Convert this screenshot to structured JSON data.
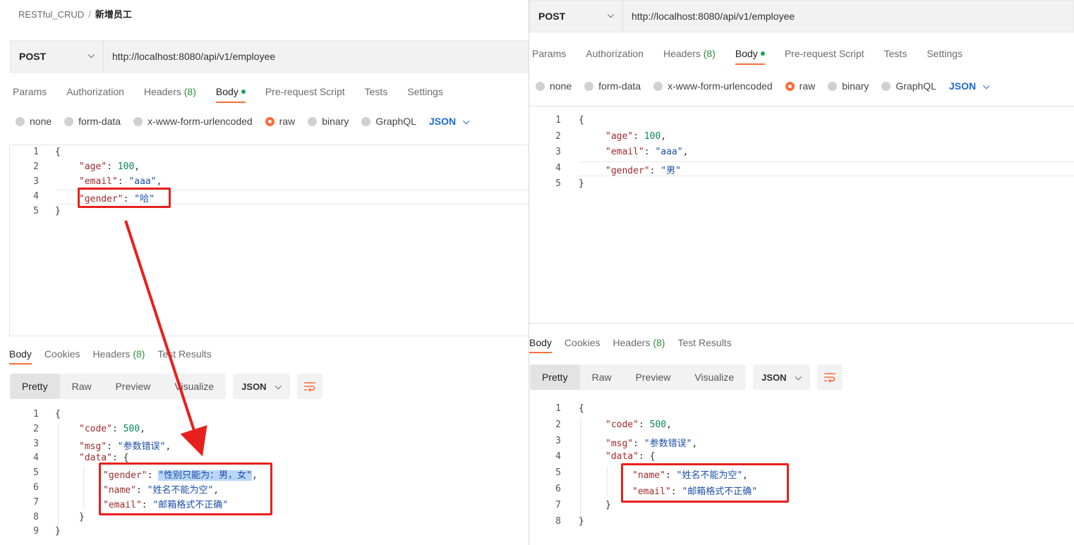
{
  "left": {
    "breadcrumb": {
      "collection": "RESTful_CRUD",
      "sep": "/",
      "request": "新增员工"
    },
    "method": "POST",
    "url": "http://localhost:8080/api/v1/employee",
    "tabs": [
      {
        "label": "Params"
      },
      {
        "label": "Authorization"
      },
      {
        "label": "Headers",
        "count": "(8)"
      },
      {
        "label": "Body",
        "active": true
      },
      {
        "label": "Pre-request Script"
      },
      {
        "label": "Tests"
      },
      {
        "label": "Settings"
      }
    ],
    "body_types": [
      "none",
      "form-data",
      "x-www-form-urlencoded",
      "raw",
      "binary",
      "GraphQL"
    ],
    "body_format": "JSON",
    "request_lines": [
      {
        "n": "1",
        "text": "{"
      },
      {
        "n": "2",
        "key": "\"age\"",
        "val": "100",
        "type": "num",
        "tail": ","
      },
      {
        "n": "3",
        "key": "\"email\"",
        "val": "\"aaa\"",
        "type": "str",
        "tail": ","
      },
      {
        "n": "4",
        "key": "\"gender\"",
        "val": "\"哈\"",
        "type": "str",
        "tail": ""
      },
      {
        "n": "5",
        "text": "}"
      }
    ],
    "resp_tabs": [
      {
        "label": "Body",
        "active": true
      },
      {
        "label": "Cookies"
      },
      {
        "label": "Headers",
        "count": "(8)"
      },
      {
        "label": "Test Results"
      }
    ],
    "views": [
      "Pretty",
      "Raw",
      "Preview",
      "Visualize"
    ],
    "resp_format": "JSON",
    "response_lines": [
      {
        "n": "1",
        "text": "{"
      },
      {
        "n": "2",
        "key": "\"code\"",
        "val": "500",
        "type": "num",
        "tail": ",",
        "indent": 1
      },
      {
        "n": "3",
        "key": "\"msg\"",
        "val": "\"参数错误\"",
        "type": "str",
        "tail": ",",
        "indent": 1
      },
      {
        "n": "4",
        "key": "\"data\"",
        "val": "{",
        "type": "punct",
        "tail": "",
        "indent": 1
      },
      {
        "n": "5",
        "key": "\"gender\"",
        "val": "\"性别只能为：男，女\"",
        "type": "str",
        "tail": ",",
        "indent": 2
      },
      {
        "n": "6",
        "key": "\"name\"",
        "val": "\"姓名不能为空\"",
        "type": "str",
        "tail": ",",
        "indent": 2
      },
      {
        "n": "7",
        "key": "\"email\"",
        "val": "\"邮箱格式不正确\"",
        "type": "str",
        "tail": "",
        "indent": 2
      },
      {
        "n": "8",
        "text": "}",
        "indent": 1
      },
      {
        "n": "9",
        "text": "}"
      }
    ]
  },
  "right": {
    "method": "POST",
    "url": "http://localhost:8080/api/v1/employee",
    "tabs": [
      {
        "label": "Params"
      },
      {
        "label": "Authorization"
      },
      {
        "label": "Headers",
        "count": "(8)"
      },
      {
        "label": "Body",
        "active": true
      },
      {
        "label": "Pre-request Script"
      },
      {
        "label": "Tests"
      },
      {
        "label": "Settings"
      }
    ],
    "body_types": [
      "none",
      "form-data",
      "x-www-form-urlencoded",
      "raw",
      "binary",
      "GraphQL"
    ],
    "body_format": "JSON",
    "request_lines": [
      {
        "n": "1",
        "text": "{"
      },
      {
        "n": "2",
        "key": "\"age\"",
        "val": "100",
        "type": "num",
        "tail": ","
      },
      {
        "n": "3",
        "key": "\"email\"",
        "val": "\"aaa\"",
        "type": "str",
        "tail": ","
      },
      {
        "n": "4",
        "key": "\"gender\"",
        "val": "\"男\"",
        "type": "str",
        "tail": ""
      },
      {
        "n": "5",
        "text": "}"
      }
    ],
    "resp_tabs": [
      {
        "label": "Body",
        "active": true
      },
      {
        "label": "Cookies"
      },
      {
        "label": "Headers",
        "count": "(8)"
      },
      {
        "label": "Test Results"
      }
    ],
    "views": [
      "Pretty",
      "Raw",
      "Preview",
      "Visualize"
    ],
    "resp_format": "JSON",
    "response_lines": [
      {
        "n": "1",
        "text": "{"
      },
      {
        "n": "2",
        "key": "\"code\"",
        "val": "500",
        "type": "num",
        "tail": ",",
        "indent": 1
      },
      {
        "n": "3",
        "key": "\"msg\"",
        "val": "\"参数错误\"",
        "type": "str",
        "tail": ",",
        "indent": 1
      },
      {
        "n": "4",
        "key": "\"data\"",
        "val": "{",
        "type": "punct",
        "tail": "",
        "indent": 1
      },
      {
        "n": "5",
        "key": "\"name\"",
        "val": "\"姓名不能为空\"",
        "type": "str",
        "tail": ",",
        "indent": 2
      },
      {
        "n": "6",
        "key": "\"email\"",
        "val": "\"邮箱格式不正确\"",
        "type": "str",
        "tail": "",
        "indent": 2
      },
      {
        "n": "7",
        "text": "}",
        "indent": 1
      },
      {
        "n": "8",
        "text": "}"
      }
    ]
  },
  "colors": {
    "accent": "#ff6c37",
    "annotation": "#e8201d",
    "link": "#1a6ad4"
  },
  "icons": {
    "dropdown": "chevron-down-icon",
    "wrap": "wrap-lines-icon"
  }
}
